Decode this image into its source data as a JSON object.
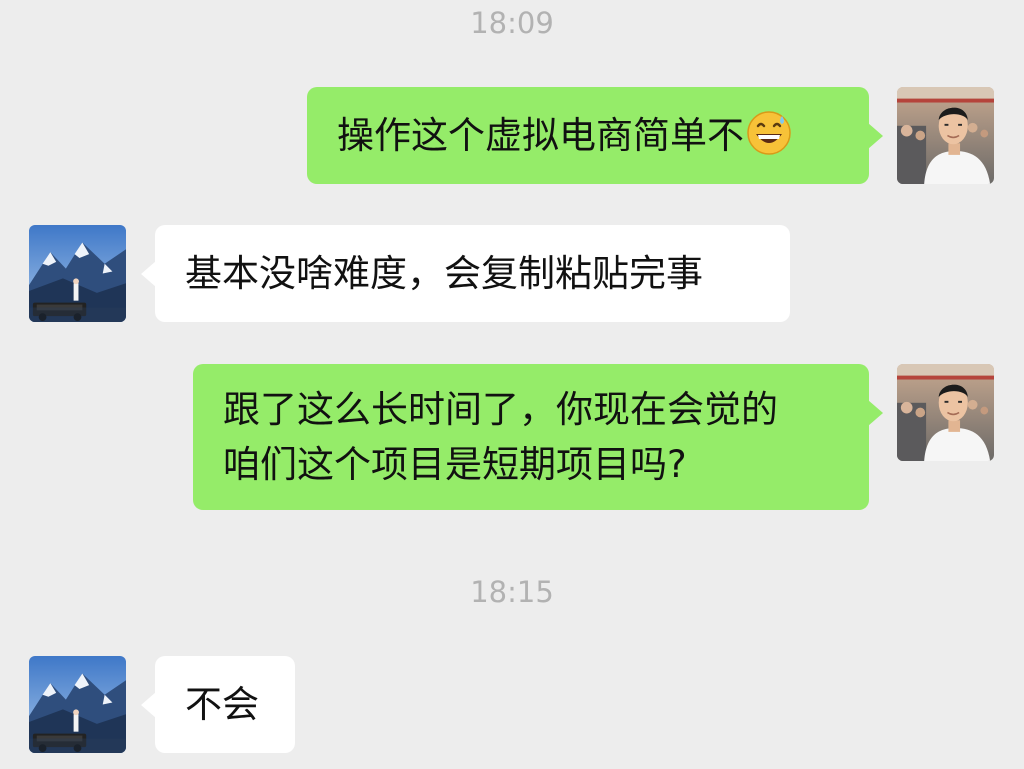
{
  "messages": [
    {
      "type": "time",
      "text": "18:09"
    },
    {
      "type": "sent",
      "lines": [
        "操作这个虚拟电商简单不"
      ],
      "emoji": "grinning-sweat-emoji"
    },
    {
      "type": "received",
      "lines": [
        "基本没啥难度，会复制粘贴完事"
      ]
    },
    {
      "type": "sent",
      "lines": [
        "跟了这么长时间了，你现在会觉的",
        "咱们这个项目是短期项目吗?"
      ]
    },
    {
      "type": "time",
      "text": "18:15"
    },
    {
      "type": "received",
      "lines": [
        "不会"
      ]
    }
  ],
  "avatars": {
    "self": "person-photo-avatar",
    "contact": "mountain-landscape-avatar"
  },
  "colors": {
    "background": "#ededed",
    "sent_bubble": "#95ec69",
    "received_bubble": "#ffffff",
    "timestamp": "#b2b2b2"
  }
}
